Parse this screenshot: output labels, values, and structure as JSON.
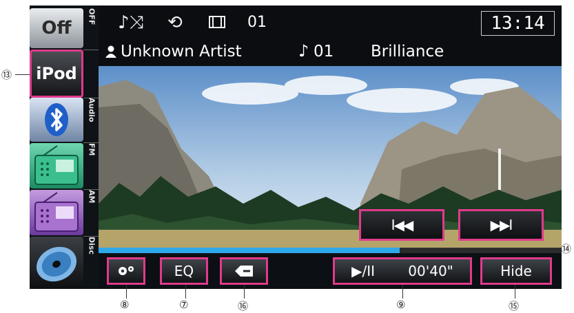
{
  "sidebar": {
    "off": {
      "label": "Off",
      "tag": "OFF"
    },
    "ipod": {
      "label": "iPod"
    },
    "bluetooth": {
      "tag": "Audio"
    },
    "fm": {
      "tag": "FM"
    },
    "am": {
      "tag": "AM"
    },
    "disc": {
      "tag": "Disc"
    }
  },
  "header": {
    "track_num": "01",
    "clock": "13:14",
    "artist": "Unknown Artist",
    "song_num": "01",
    "song_title": "Brilliance"
  },
  "controls": {
    "prev_label": "I◀◀",
    "next_label": "▶▶I",
    "eq_label": "EQ",
    "playpause_label": "▶/II",
    "elapsed": "00'40\"",
    "hide_label": "Hide",
    "progress_fraction": 0.65
  },
  "callouts": {
    "c13": "⑬",
    "c14": "⑭",
    "c8": "⑧",
    "c7": "⑦",
    "c16": "⑯",
    "c9": "⑨",
    "c15": "⑮"
  },
  "colors": {
    "highlight": "#e13a8c",
    "progress": "#2ea8e8"
  }
}
